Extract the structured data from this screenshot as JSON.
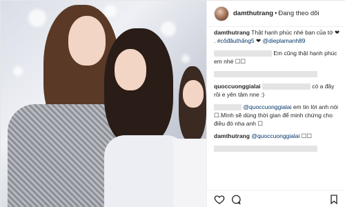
{
  "header": {
    "username": "damthutrang",
    "separator": "•",
    "follow_status": "Đang theo dõi"
  },
  "comments": [
    {
      "username": "damthutrang",
      "text_1": "Thật hạnh phúc nhé bạn của tớ ❤ . ",
      "hashtag": "#côđâuthấng5",
      "text_2": "❤ ",
      "mention": "@dieplamanh89"
    },
    {
      "text": "Em cũng thật hạnh phúc em nhé ☐☐"
    },
    {
      "username": "quoccuonggialai",
      "text": "có a đây rồi e yên tâm nne :)"
    },
    {
      "mention": "@quoccuonggialai",
      "text": "em tin lời anh nói ☐.Mình sẽ dùng thời gian để minh chứng cho điều đó nha anh ☐"
    },
    {
      "username": "damthutrang",
      "mention": "@quoccuonggialai",
      "text": "☐☐"
    }
  ],
  "icons": {
    "like": "heart-icon",
    "comment": "comment-bubble-icon",
    "save": "bookmark-icon",
    "avatar": "profile-avatar"
  }
}
